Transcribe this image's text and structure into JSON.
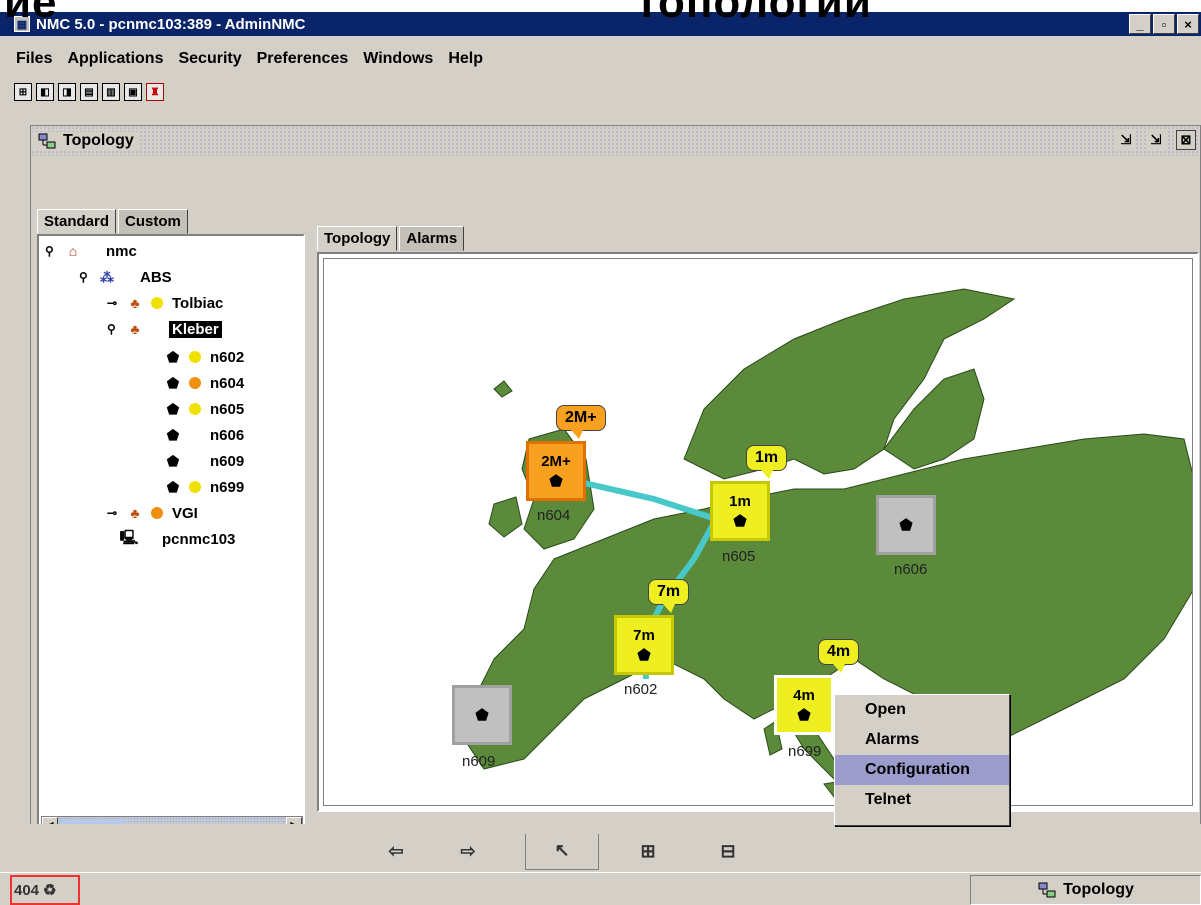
{
  "slide": {
    "left_text": "ие",
    "right_text": "топологии"
  },
  "window": {
    "title": "NMC 5.0 - pcnmc103:389 - AdminNMC",
    "min": "_",
    "max": "▫",
    "close": "×"
  },
  "menu": [
    "Files",
    "Applications",
    "Security",
    "Preferences",
    "Windows",
    "Help"
  ],
  "internal_frame": {
    "title": "Topology"
  },
  "left_tabs": [
    "Standard",
    "Custom"
  ],
  "tree": [
    {
      "label": "nmc"
    },
    {
      "label": "ABS"
    },
    {
      "label": "Tolbiac",
      "status": "#f0e000"
    },
    {
      "label": "Kleber",
      "selected": true
    },
    {
      "label": "n602",
      "status": "#f0e000"
    },
    {
      "label": "n604",
      "status": "#f09010"
    },
    {
      "label": "n605",
      "status": "#f0e000"
    },
    {
      "label": "n606"
    },
    {
      "label": "n609"
    },
    {
      "label": "n699",
      "status": "#f0e000"
    },
    {
      "label": "VGI",
      "status": "#f09010"
    },
    {
      "label": "pcnmc103"
    }
  ],
  "right_tabs": [
    "Topology",
    "Alarms"
  ],
  "devices": [
    {
      "name": "n604",
      "value": "2M+",
      "bubble": "2M+",
      "color": "#f8a020"
    },
    {
      "name": "n605",
      "value": "1m",
      "bubble": "1m",
      "color": "#eeee20"
    },
    {
      "name": "n602",
      "value": "7m",
      "bubble": "7m",
      "color": "#eeee20"
    },
    {
      "name": "n699",
      "value": "4m",
      "bubble": "4m",
      "color": "#eeee20"
    },
    {
      "name": "n606",
      "value": "",
      "bubble": "",
      "color": "#c0c0c0"
    },
    {
      "name": "n609",
      "value": "",
      "bubble": "",
      "color": "#c0c0c0"
    }
  ],
  "context_menu": [
    "Open",
    "Alarms",
    "Configuration",
    "Telnet"
  ],
  "status": {
    "count": "404",
    "taskbar_label": "Topology"
  },
  "colors": {
    "title_bar": "#0a246a",
    "map_land": "#5a8a3a",
    "menu_highlight": "#9c9ccc",
    "link": "#48c8c8"
  }
}
